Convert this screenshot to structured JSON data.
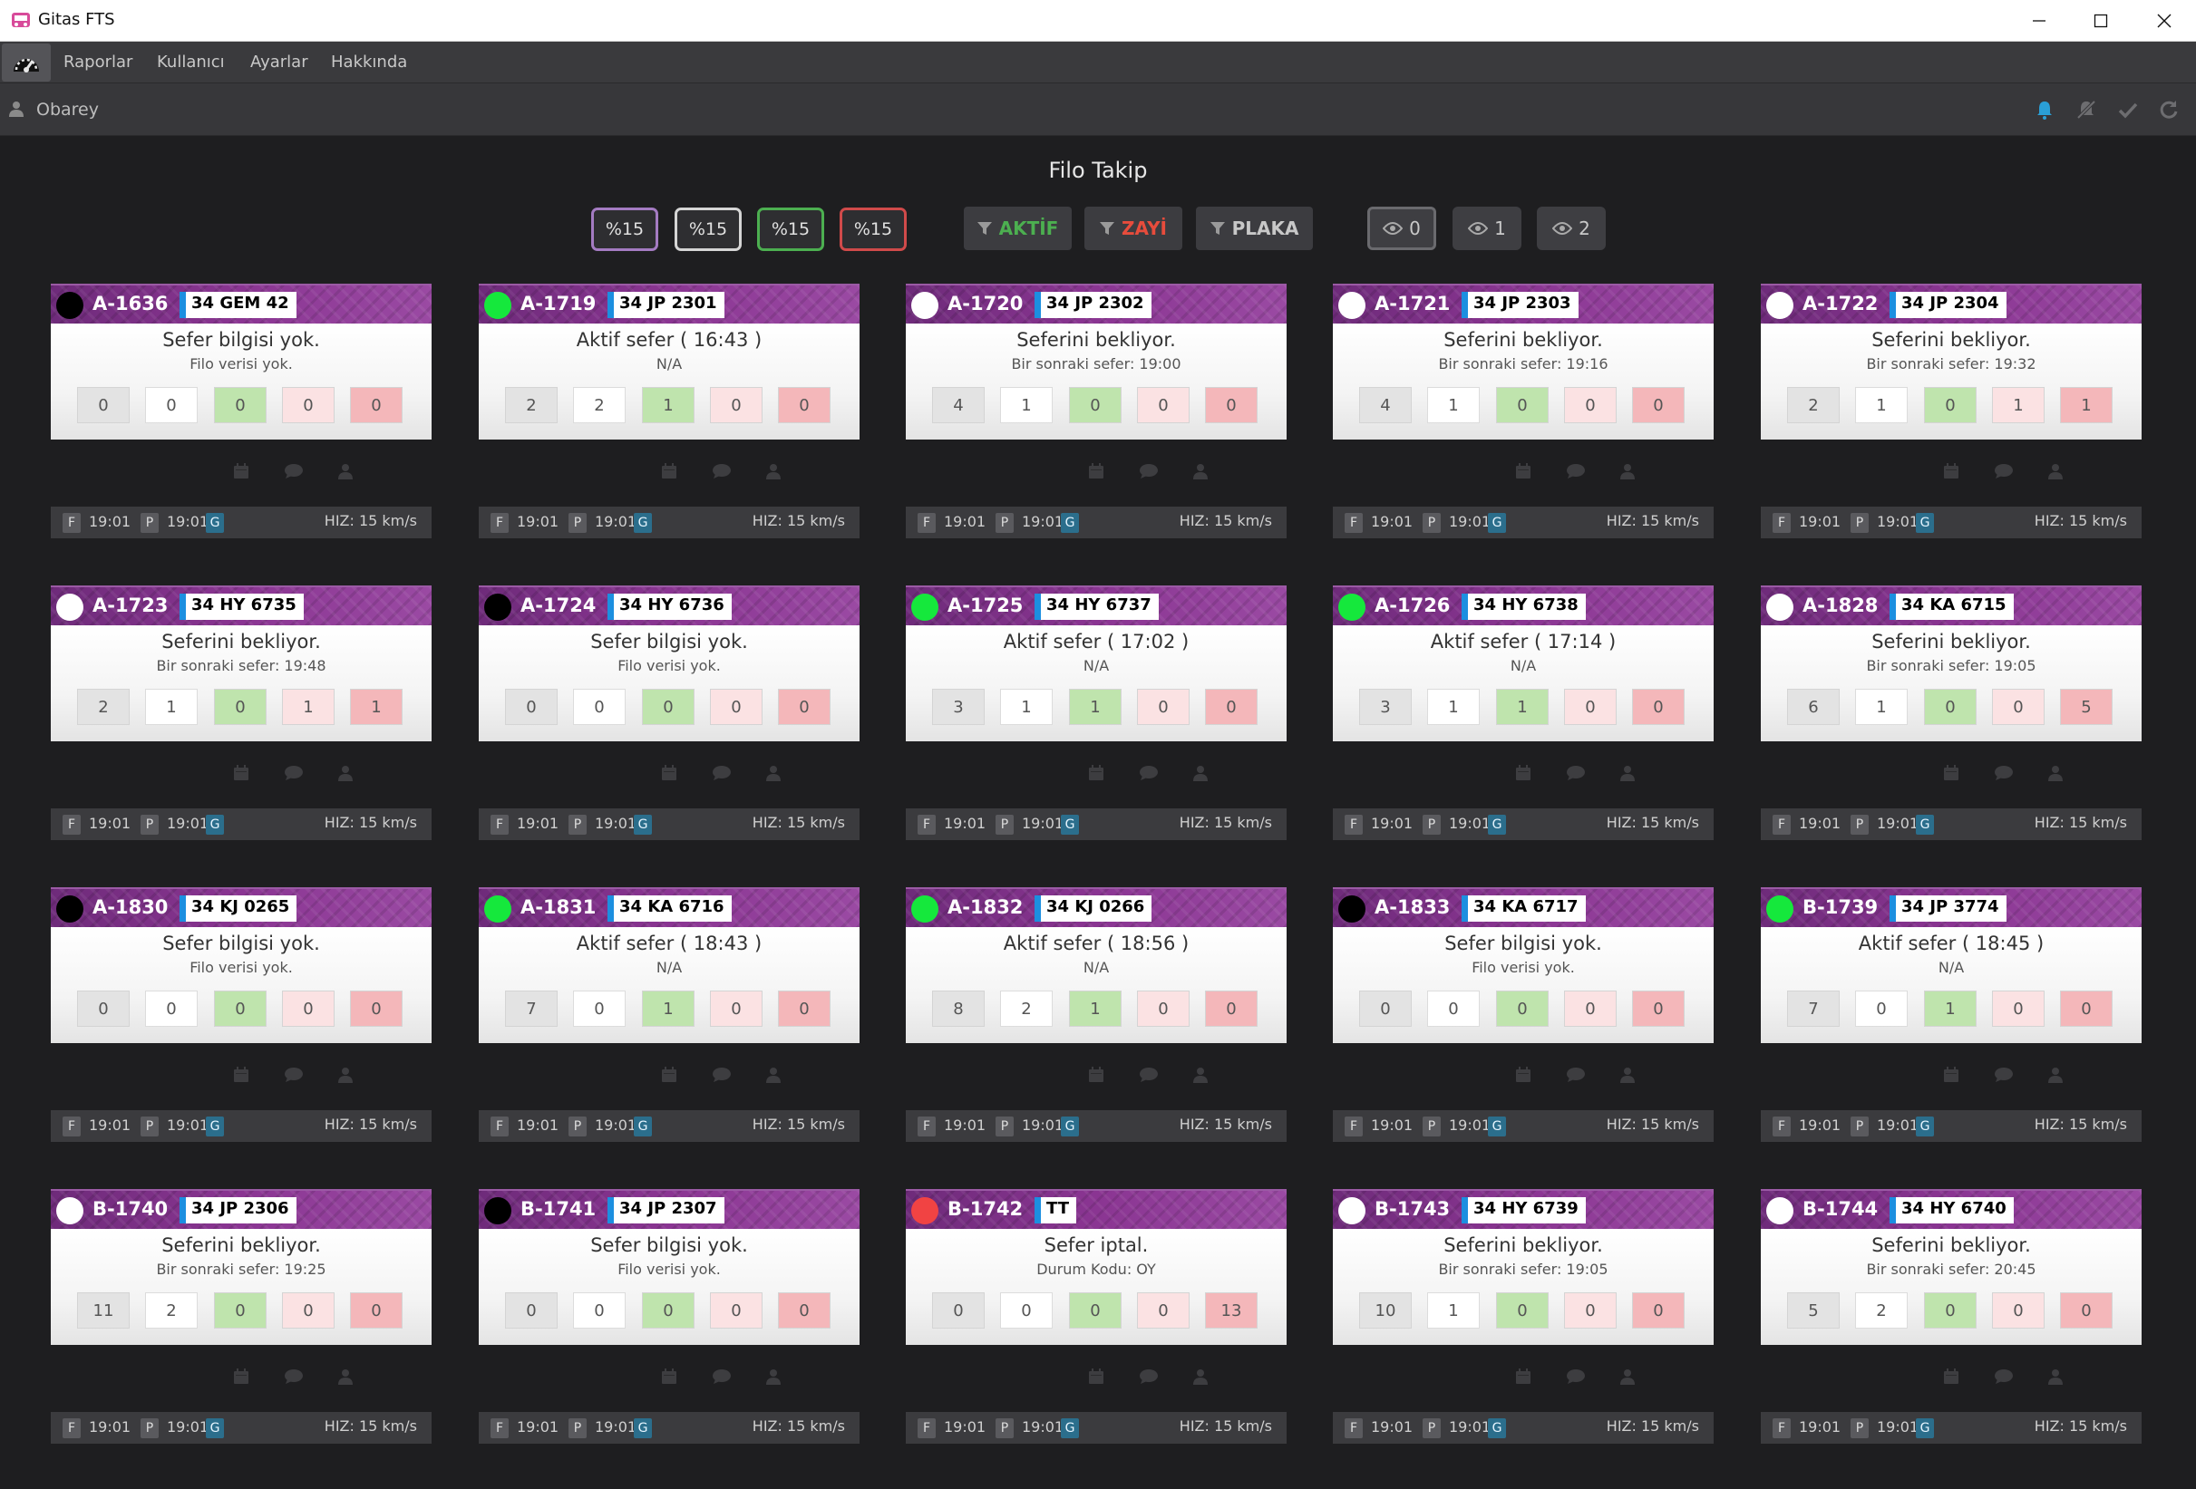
{
  "window": {
    "title": "Gitas FTS"
  },
  "menu": {
    "items": [
      "Raporlar",
      "Kullanıcı",
      "Ayarlar",
      "Hakkında"
    ]
  },
  "user": {
    "name": "Obarey"
  },
  "page": {
    "title": "Filo Takip"
  },
  "percent_buttons": [
    {
      "label": "%15",
      "color": "#a47bc2"
    },
    {
      "label": "%15",
      "color": "#d5d5d5"
    },
    {
      "label": "%15",
      "color": "#4caf50"
    },
    {
      "label": "%15",
      "color": "#d04a4a"
    }
  ],
  "filters": [
    {
      "label": "AKTİF",
      "color": "#4caf50"
    },
    {
      "label": "ZAYİ",
      "color": "#e74c3c"
    },
    {
      "label": "PLAKA",
      "color": "#c8c8c8"
    }
  ],
  "view_buttons": [
    {
      "label": "0",
      "selected": true
    },
    {
      "label": "1",
      "selected": false
    },
    {
      "label": "2",
      "selected": false
    }
  ],
  "status_colors": {
    "active": "#15e83c",
    "waiting": "#ffffff",
    "none": "#000000",
    "cancelled": "#f14343"
  },
  "cards": [
    {
      "id": "A-1636",
      "plate": "34 GEM 42",
      "status": "none",
      "text": "Sefer bilgisi yok.",
      "sub": "Filo verisi yok.",
      "counts": [
        "0",
        "0",
        "0",
        "0",
        "0"
      ],
      "f_time": "19:01",
      "p_time": "19:01",
      "speed": "HIZ: 15 km/s"
    },
    {
      "id": "A-1719",
      "plate": "34 JP 2301",
      "status": "active",
      "text": "Aktif sefer ( 16:43 )",
      "sub": "N/A",
      "counts": [
        "2",
        "2",
        "1",
        "0",
        "0"
      ],
      "f_time": "19:01",
      "p_time": "19:01",
      "speed": "HIZ: 15 km/s"
    },
    {
      "id": "A-1720",
      "plate": "34 JP 2302",
      "status": "waiting",
      "text": "Seferini bekliyor.",
      "sub": "Bir sonraki sefer: 19:00",
      "counts": [
        "4",
        "1",
        "0",
        "0",
        "0"
      ],
      "f_time": "19:01",
      "p_time": "19:01",
      "speed": "HIZ: 15 km/s"
    },
    {
      "id": "A-1721",
      "plate": "34 JP 2303",
      "status": "waiting",
      "text": "Seferini bekliyor.",
      "sub": "Bir sonraki sefer: 19:16",
      "counts": [
        "4",
        "1",
        "0",
        "0",
        "0"
      ],
      "f_time": "19:01",
      "p_time": "19:01",
      "speed": "HIZ: 15 km/s"
    },
    {
      "id": "A-1722",
      "plate": "34 JP 2304",
      "status": "waiting",
      "text": "Seferini bekliyor.",
      "sub": "Bir sonraki sefer: 19:32",
      "counts": [
        "2",
        "1",
        "0",
        "1",
        "1"
      ],
      "f_time": "19:01",
      "p_time": "19:01",
      "speed": "HIZ: 15 km/s"
    },
    {
      "id": "A-1723",
      "plate": "34 HY 6735",
      "status": "waiting",
      "text": "Seferini bekliyor.",
      "sub": "Bir sonraki sefer: 19:48",
      "counts": [
        "2",
        "1",
        "0",
        "1",
        "1"
      ],
      "f_time": "19:01",
      "p_time": "19:01",
      "speed": "HIZ: 15 km/s"
    },
    {
      "id": "A-1724",
      "plate": "34 HY 6736",
      "status": "none",
      "text": "Sefer bilgisi yok.",
      "sub": "Filo verisi yok.",
      "counts": [
        "0",
        "0",
        "0",
        "0",
        "0"
      ],
      "f_time": "19:01",
      "p_time": "19:01",
      "speed": "HIZ: 15 km/s"
    },
    {
      "id": "A-1725",
      "plate": "34 HY 6737",
      "status": "active",
      "text": "Aktif sefer ( 17:02 )",
      "sub": "N/A",
      "counts": [
        "3",
        "1",
        "1",
        "0",
        "0"
      ],
      "f_time": "19:01",
      "p_time": "19:01",
      "speed": "HIZ: 15 km/s"
    },
    {
      "id": "A-1726",
      "plate": "34 HY 6738",
      "status": "active",
      "text": "Aktif sefer ( 17:14 )",
      "sub": "N/A",
      "counts": [
        "3",
        "1",
        "1",
        "0",
        "0"
      ],
      "f_time": "19:01",
      "p_time": "19:01",
      "speed": "HIZ: 15 km/s"
    },
    {
      "id": "A-1828",
      "plate": "34 KA 6715",
      "status": "waiting",
      "text": "Seferini bekliyor.",
      "sub": "Bir sonraki sefer: 19:05",
      "counts": [
        "6",
        "1",
        "0",
        "0",
        "5"
      ],
      "f_time": "19:01",
      "p_time": "19:01",
      "speed": "HIZ: 15 km/s"
    },
    {
      "id": "A-1830",
      "plate": "34 KJ 0265",
      "status": "none",
      "text": "Sefer bilgisi yok.",
      "sub": "Filo verisi yok.",
      "counts": [
        "0",
        "0",
        "0",
        "0",
        "0"
      ],
      "f_time": "19:01",
      "p_time": "19:01",
      "speed": "HIZ: 15 km/s"
    },
    {
      "id": "A-1831",
      "plate": "34 KA 6716",
      "status": "active",
      "text": "Aktif sefer ( 18:43 )",
      "sub": "N/A",
      "counts": [
        "7",
        "0",
        "1",
        "0",
        "0"
      ],
      "f_time": "19:01",
      "p_time": "19:01",
      "speed": "HIZ: 15 km/s"
    },
    {
      "id": "A-1832",
      "plate": "34 KJ 0266",
      "status": "active",
      "text": "Aktif sefer ( 18:56 )",
      "sub": "N/A",
      "counts": [
        "8",
        "2",
        "1",
        "0",
        "0"
      ],
      "f_time": "19:01",
      "p_time": "19:01",
      "speed": "HIZ: 15 km/s"
    },
    {
      "id": "A-1833",
      "plate": "34 KA 6717",
      "status": "none",
      "text": "Sefer bilgisi yok.",
      "sub": "Filo verisi yok.",
      "counts": [
        "0",
        "0",
        "0",
        "0",
        "0"
      ],
      "f_time": "19:01",
      "p_time": "19:01",
      "speed": "HIZ: 15 km/s"
    },
    {
      "id": "B-1739",
      "plate": "34 JP 3774",
      "status": "active",
      "text": "Aktif sefer ( 18:45 )",
      "sub": "N/A",
      "counts": [
        "7",
        "0",
        "1",
        "0",
        "0"
      ],
      "f_time": "19:01",
      "p_time": "19:01",
      "speed": "HIZ: 15 km/s"
    },
    {
      "id": "B-1740",
      "plate": "34 JP 2306",
      "status": "waiting",
      "text": "Seferini bekliyor.",
      "sub": "Bir sonraki sefer: 19:25",
      "counts": [
        "11",
        "2",
        "0",
        "0",
        "0"
      ],
      "f_time": "19:01",
      "p_time": "19:01",
      "speed": "HIZ: 15 km/s"
    },
    {
      "id": "B-1741",
      "plate": "34 JP 2307",
      "status": "none",
      "text": "Sefer bilgisi yok.",
      "sub": "Filo verisi yok.",
      "counts": [
        "0",
        "0",
        "0",
        "0",
        "0"
      ],
      "f_time": "19:01",
      "p_time": "19:01",
      "speed": "HIZ: 15 km/s"
    },
    {
      "id": "B-1742",
      "plate": "TT",
      "status": "cancelled",
      "text": "Sefer iptal.",
      "sub": "Durum Kodu: OY",
      "counts": [
        "0",
        "0",
        "0",
        "0",
        "13"
      ],
      "f_time": "19:01",
      "p_time": "19:01",
      "speed": "HIZ: 15 km/s"
    },
    {
      "id": "B-1743",
      "plate": "34 HY 6739",
      "status": "waiting",
      "text": "Seferini bekliyor.",
      "sub": "Bir sonraki sefer: 19:05",
      "counts": [
        "10",
        "1",
        "0",
        "0",
        "0"
      ],
      "f_time": "19:01",
      "p_time": "19:01",
      "speed": "HIZ: 15 km/s"
    },
    {
      "id": "B-1744",
      "plate": "34 HY 6740",
      "status": "waiting",
      "text": "Seferini bekliyor.",
      "sub": "Bir sonraki sefer: 20:45",
      "counts": [
        "5",
        "2",
        "0",
        "0",
        "0"
      ],
      "f_time": "19:01",
      "p_time": "19:01",
      "speed": "HIZ: 15 km/s"
    }
  ],
  "footer_tags": {
    "f": "F",
    "p": "P",
    "g": "G"
  }
}
